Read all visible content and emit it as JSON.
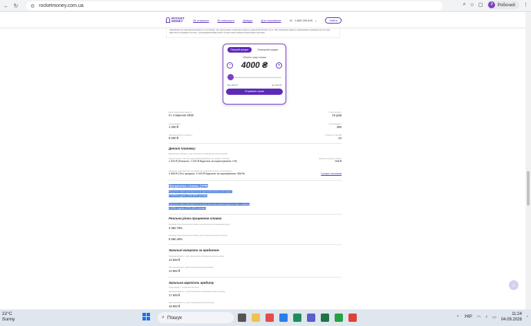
{
  "browser": {
    "url": "rocketmoney.com.ua",
    "profile_initial": "Р",
    "profile_name": "Робочий"
  },
  "site": {
    "logo_line1": "ROCKET",
    "logo_line2": "MONEY",
    "nav": [
      "Як отримати",
      "Як повернути",
      "Довідка",
      "Для споживачів"
    ],
    "phone": "0 800 200 620",
    "login": "Увійти",
    "info_text": "інформації про виконання кредитного договору, про дострокове погашення кредиту, додаткові витрати та ін. При погашенні кредиту нарахування проводиться на суму фактично отриманих коштів, з урахуванням фактичного строку користування кредитними коштами."
  },
  "calculator": {
    "tab_first": "Перший кредит",
    "tab_repeat": "Повторний кредит",
    "amount_label": "Оберіть суму позики",
    "amount": "4000 ₴",
    "min": "Від 3000 ₴",
    "max": "До 4000 ₴",
    "cta": "Отримати гроші"
  },
  "summary": {
    "return_date_label": "Дата повернення кредиту",
    "return_date": "пт, 4 вересня 2026",
    "term_label": "Строк кредиту",
    "term": "15 днів",
    "amount_label": "Сума кредиту",
    "amount": "1 000 ₴",
    "period_label": "Строк кредиту",
    "period": "360",
    "total_label": "Загальна вартість кредиту",
    "total": "9 000 ₴",
    "count_label": "Кількість платежів",
    "count": "24"
  },
  "details": {
    "title": "Деталі платежу:",
    "subtitle": "Визначення платежу у разі своєчасного виконання умов договору",
    "first_label": "Сума першого платежу, нарахована відповідно до графіку платежів",
    "first": "1 000 ₴ (Рахунок: 1 000 ₴ Відсотки за користування: 0 ₴)",
    "first_right_label": "Загальна сума до сплати",
    "first_right": "558 ₴",
    "last_label": "Загальна сума відсотків та комісій за договором за весь строк кредиту",
    "last": "4 558 ₴ (Тіло кредиту: 4 000 ₴ Відсотки за нарахування: 558 ₴)",
    "schedule_link": "Графік платежів"
  },
  "apr": {
    "title": "Процентна ставка (APR)",
    "line1": "Процентна ставка нараховується на фактичний залишок суми кредиту",
    "value1": "0.015% в день (229.85% річних)",
    "line2": "Процентна ставка нараховується за кожен день користування кредитом згідно з графіком",
    "value2": "1.03% в день (378.45% річних)"
  },
  "real_rate": {
    "title": "Реальна річна процентна ставка",
    "note1": "Реальна річна процентна ставка у разі своєчасного виконання умов",
    "value1": "3 360.79%",
    "note2": "Реальна річна процентна ставка у разі порушення умов договору",
    "value2": "5 560.49%"
  },
  "costs": {
    "title": "Загальні витрати за кредитом",
    "note1": "Загальні витрати у разі своєчасного виконання умов договору",
    "value1": "13 848 ₴",
    "note2": "Загальні витрати у разі порушення умов договору",
    "value2": "14 992 ₴"
  },
  "total_cost": {
    "title": "Загальна вартість кредиту",
    "subtitle": "Сума кредиту та загальні витрати",
    "note1": "Загальна вартість у разі своєчасного виконання умов договору",
    "value1": "17 848 ₴",
    "note2": "Загальна вартість у разі порушення умов договору",
    "value2": "18 992 ₴"
  },
  "taskbar": {
    "temp": "22°C",
    "weather": "Sunny",
    "search": "Пошук",
    "lang": "УКР",
    "time": "11:24",
    "date": "04.09.2026"
  }
}
